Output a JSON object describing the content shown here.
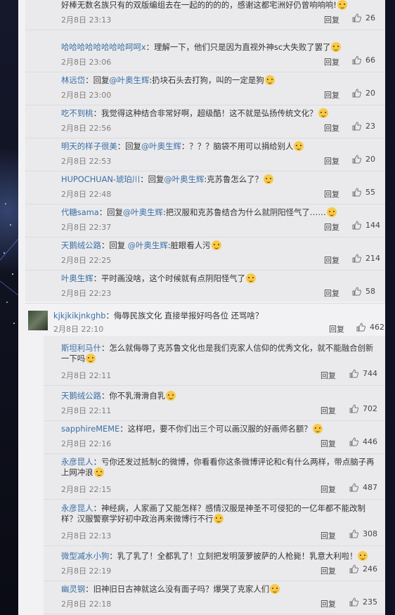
{
  "replies": [
    {
      "user": "",
      "text": "好棒无数名族只有的双版编组去在一起的的的的，感谢这都宅洲好仍曾响响响!",
      "time": "2月8日 23:13",
      "reply": "回复",
      "likes": "26"
    },
    {
      "user": "哈哈哈哈哈哈哈哈呵呵x",
      "text": "：理解一下，他们只是因为直视外神sc大失败了罢了",
      "time": "2月8日 23:06",
      "reply": "回复",
      "likes": "66"
    },
    {
      "user": "林远岱",
      "text": "：回复",
      "mention": "@叶奥生辉",
      "text2": ":扔块石头去打狗，叫的一定是狗",
      "time": "2月8日 23:00",
      "reply": "回复",
      "likes": "20"
    },
    {
      "user": "吃不到桃",
      "text": "：我觉得这种结合非常好啊，超级酷！这不就是弘扬传统文化？",
      "time": "2月8日 22:56",
      "reply": "回复",
      "likes": "23"
    },
    {
      "user": "明天的样子很美",
      "text": "：回复",
      "mention": "@叶奥生辉",
      "text2": "：？？？脑袋不用可以捐给别人",
      "time": "2月8日 22:53",
      "reply": "回复",
      "likes": "20"
    },
    {
      "user": "HUPOCHUAN-琥珀川",
      "text": "：回复",
      "mention": "@叶奥生辉",
      "text2": ":克苏鲁怎么了？",
      "time": "2月8日 22:48",
      "reply": "回复",
      "likes": "55"
    },
    {
      "user": "代糖sama",
      "text": "：回复",
      "mention": "@叶奥生辉",
      "text2": ":把汉服和克苏鲁结合为什么就阴阳怪气了……",
      "time": "2月8日 22:37",
      "reply": "回复",
      "likes": "144"
    },
    {
      "user": "天鹅绒公路",
      "text": "：回复 ",
      "mention": "@叶奥生辉",
      "text2": ":脏眼看人污",
      "time": "2月8日 22:25",
      "reply": "回复",
      "likes": "214"
    },
    {
      "user": "叶奥生辉",
      "text": "：平时画没啥，这个时候就有点阴阳怪气了",
      "time": "2月8日 22:23",
      "reply": "回复",
      "likes": "58"
    }
  ],
  "top_comment": {
    "user": "kjkjkikjnkghb",
    "text": "：侮辱民族文化 直接举报好吗各位 还骂啥？",
    "time": "2月8日 22:10",
    "reply": "回复",
    "likes": "462"
  },
  "replies2": [
    {
      "user": "斯坦利马什",
      "text": "：怎么就侮辱了",
      "text2": "克苏鲁文化也是我们克家人信仰的优秀文化，就不能融合创新一下吗",
      "time": "2月8日 22:11",
      "reply": "回复",
      "likes": "744"
    },
    {
      "user": "天鹅绒公路",
      "text": "：你不乳滑滑自乳",
      "time": "2月8日 22:11",
      "reply": "回复",
      "likes": "702"
    },
    {
      "user": "sapphireMEME",
      "text": "：这样吧，要不你们出三个可以画汉服的好画师名额？",
      "time": "2月8日 22:16",
      "reply": "回复",
      "likes": "446"
    },
    {
      "user": "永彦昆人",
      "text": "：亏你还发过抵制c的微博，你看看你这条微博评论和c有什么两样，带点脑子再上网冲浪",
      "time": "2月8日 22:15",
      "reply": "回复",
      "likes": "487"
    },
    {
      "user": "永彦昆人",
      "text": "：神经病，人家画了又能怎样？感情汉服是神圣不可侵犯的一亿年都不能改制样？汉服警察学好初中政治再来微博行不行",
      "time": "2月8日 22:13",
      "reply": "回复",
      "likes": "308"
    },
    {
      "user": "微型减水小狗",
      "text": "：乳了乳了！全都乳了！立刻把发明菠萝披萨的人枪毙！乳意大利啦！",
      "time": "2月8日 22:19",
      "reply": "回复",
      "likes": "246"
    },
    {
      "user": "幽灵钢",
      "text": "：旧神旧日古神就这么没有面子吗？爆哭了克家人们",
      "time": "2月8日 22:18",
      "reply": "回复",
      "likes": "235"
    }
  ],
  "colors": {
    "username": "#3b6ea5",
    "panel": "#eaeaec",
    "bg": "#0b0d1a"
  },
  "icons": [
    "thumb-up-icon",
    "smile-emoji-icon",
    "verified-badge-icon",
    "avatar-image"
  ]
}
